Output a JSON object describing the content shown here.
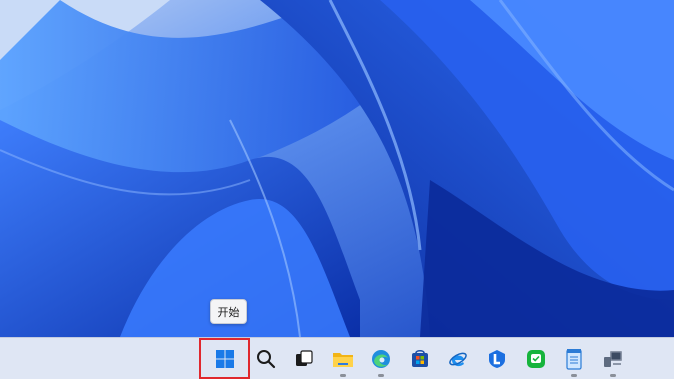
{
  "tooltip": {
    "text": "开始"
  },
  "taskbar": {
    "items": [
      {
        "name": "start-button",
        "icon": "windows-logo-icon",
        "running": false
      },
      {
        "name": "search-button",
        "icon": "search-icon",
        "running": false
      },
      {
        "name": "task-view-button",
        "icon": "task-view-icon",
        "running": false
      },
      {
        "name": "file-explorer-button",
        "icon": "folder-icon",
        "running": true
      },
      {
        "name": "edge-button",
        "icon": "edge-icon",
        "running": true
      },
      {
        "name": "store-button",
        "icon": "store-icon",
        "running": false
      },
      {
        "name": "ie-button",
        "icon": "ie-icon",
        "running": false
      },
      {
        "name": "app-l-button",
        "icon": "blue-l-app-icon",
        "running": false
      },
      {
        "name": "wechat-button",
        "icon": "wechat-icon",
        "running": false
      },
      {
        "name": "notepad-button",
        "icon": "notepad-icon",
        "running": true
      },
      {
        "name": "app-pc-button",
        "icon": "computer-icon",
        "running": true
      }
    ]
  },
  "colors": {
    "accent": "#1e5be8",
    "highlight": "#e0282e",
    "taskbar": "#dfe6f4"
  }
}
